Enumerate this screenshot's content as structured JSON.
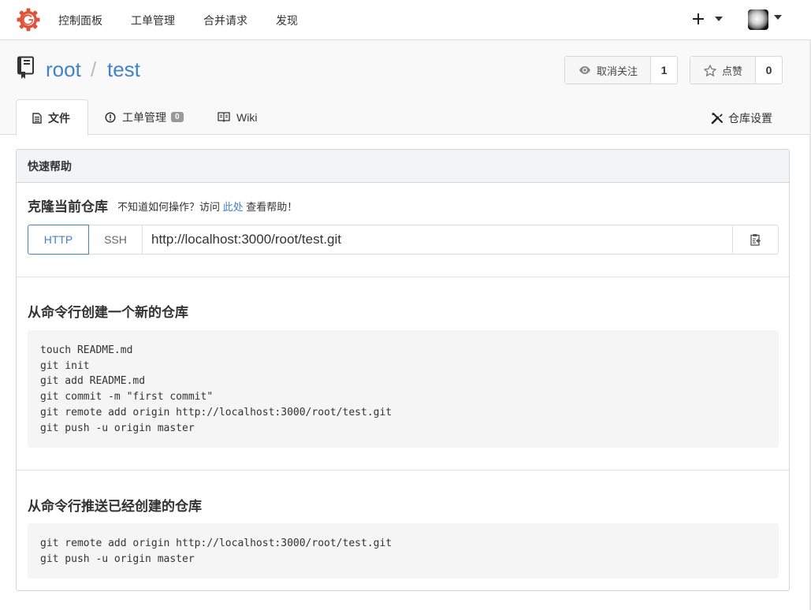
{
  "nav": {
    "items": [
      {
        "label": "控制面板"
      },
      {
        "label": "工单管理"
      },
      {
        "label": "合并请求"
      },
      {
        "label": "发现"
      }
    ],
    "plus_label": "+"
  },
  "repo": {
    "owner": "root",
    "separator": "/",
    "name": "test",
    "watch": {
      "label": "取消关注",
      "count": "1"
    },
    "star": {
      "label": "点赞",
      "count": "0"
    }
  },
  "tabs": [
    {
      "label": "文件",
      "active": true
    },
    {
      "label": "工单管理",
      "badge": "0"
    },
    {
      "label": "Wiki"
    }
  ],
  "settings_label": "仓库设置",
  "quick_help": {
    "header": "快速帮助",
    "clone_title": "克隆当前仓库",
    "clone_hint_prefix": "不知道如何操作？访问",
    "clone_hint_link": "此处",
    "clone_hint_suffix": "查看帮助！",
    "protocols": [
      "HTTP",
      "SSH"
    ],
    "clone_url": "http://localhost:3000/root/test.git"
  },
  "new_repo": {
    "title": "从命令行创建一个新的仓库",
    "code": "touch README.md\ngit init\ngit add README.md\ngit commit -m \"first commit\"\ngit remote add origin http://localhost:3000/root/test.git\ngit push -u origin master"
  },
  "push_existing": {
    "title": "从命令行推送已经创建的仓库",
    "code": "git remote add origin http://localhost:3000/root/test.git\ngit push -u origin master"
  },
  "colors": {
    "accent": "#4183c4",
    "logo": "#e0533b"
  },
  "icons": [
    "gogs-logo-icon",
    "plus-icon",
    "caret-down-icon",
    "avatar",
    "repo-icon",
    "eye-icon",
    "star-icon",
    "file-text-icon",
    "issue-opened-icon",
    "book-icon",
    "tools-icon",
    "clippy-icon"
  ]
}
